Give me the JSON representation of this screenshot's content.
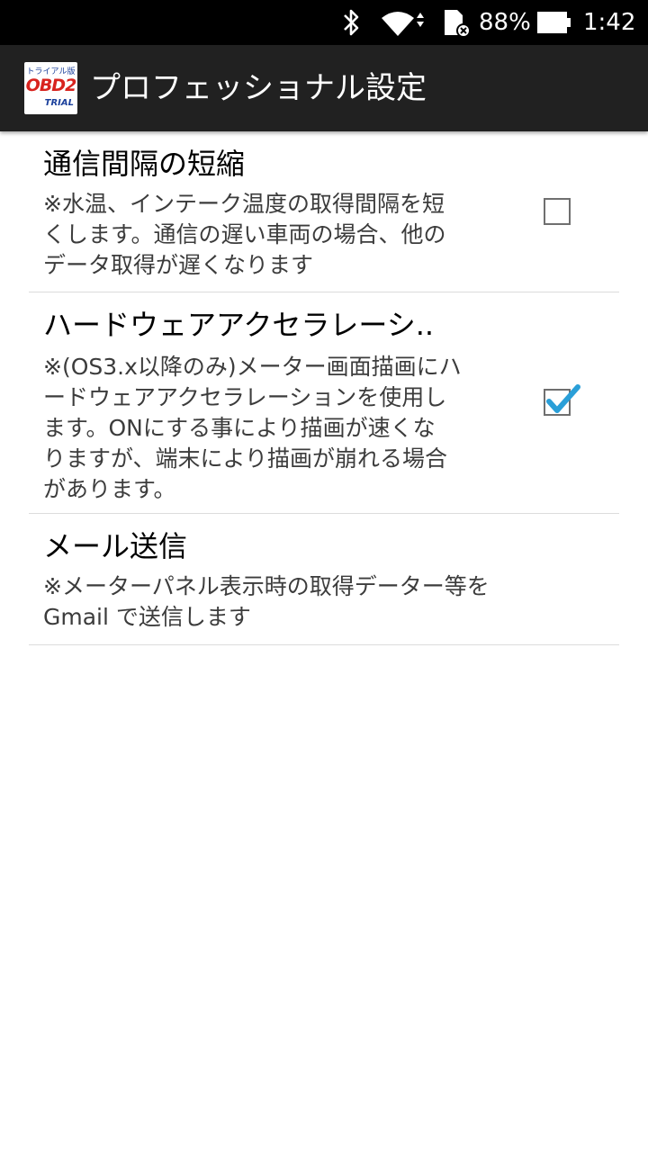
{
  "status_bar": {
    "battery_text": "88%",
    "time": "1:42",
    "icons": [
      "bluetooth-icon",
      "wifi-icon",
      "sd-card-icon",
      "battery-icon"
    ]
  },
  "action_bar": {
    "logo": {
      "top_text": "トライアル版",
      "main_text": "OBD2",
      "bottom_text": "TRIAL"
    },
    "title": "プロフェッショナル設定"
  },
  "preferences": [
    {
      "title": "通信間隔の短縮",
      "summary_lines": [
        "※水温、インテーク温度の取得間隔を短",
        "くします。通信の遅い車両の場合、他の",
        "データ取得が遅くなります"
      ],
      "checked": false
    },
    {
      "title": "ハードウェアアクセラレーシ..",
      "summary_lines": [
        "※(OS3.x以降のみ)メーター画面描画にハ",
        "ードウェアアクセラレーションを使用し",
        "ます。ONにする事により描画が速くな",
        "りますが、端末により描画が崩れる場合",
        "があります。"
      ],
      "checked": true
    },
    {
      "title": "メール送信",
      "summary_lines": [
        "※メーターパネル表示時の取得データー等を",
        "Gmail で送信します"
      ]
    }
  ],
  "colors": {
    "status_bar_bg": "#000000",
    "action_bar_bg": "#212121",
    "checkmark": "#2a9fd8",
    "divider": "#dcdcdc"
  }
}
